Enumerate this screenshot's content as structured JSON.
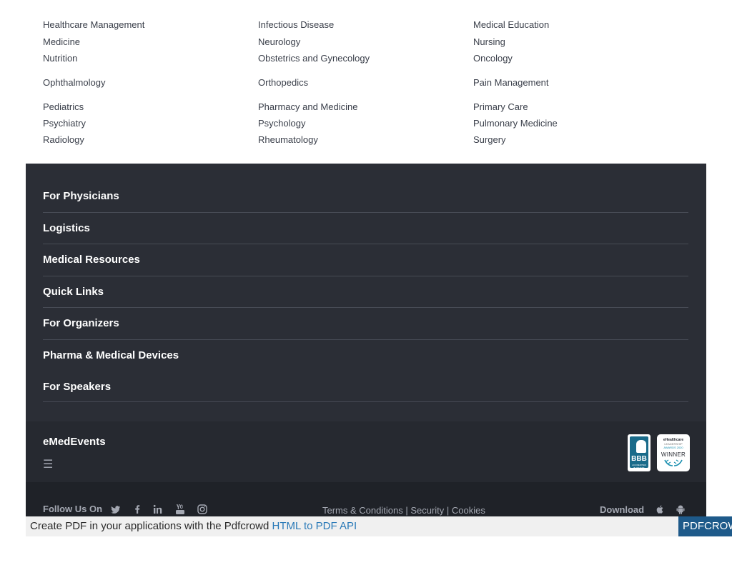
{
  "specialties": [
    [
      "Healthcare Management",
      "Infectious Disease",
      "Medical Education"
    ],
    [
      "Medicine",
      "Neurology",
      "Nursing"
    ],
    [
      "Nutrition",
      "Obstetrics and Gynecology",
      "Oncology"
    ],
    [
      "Ophthalmology",
      "Orthopedics",
      "Pain Management"
    ],
    [
      "Pediatrics",
      "Pharmacy and Medicine",
      "Primary Care"
    ],
    [
      "Psychiatry",
      "Psychology",
      "Pulmonary Medicine"
    ],
    [
      "Radiology",
      "Rheumatology",
      "Surgery"
    ]
  ],
  "footer_menu": [
    "For Physicians",
    "Logistics",
    "Medical Resources",
    "Quick Links",
    "For Organizers",
    "Pharma & Medical Devices",
    "For Speakers"
  ],
  "brand": {
    "name": "eMedEvents",
    "menu_icon": "☰"
  },
  "badges": {
    "bbb": {
      "title": "BBB",
      "subtitle": "ACCREDITED BUSINESS"
    },
    "award": {
      "line1": "eHealthcare",
      "line2": "LEADERSHIP",
      "line3": "AWARDS 2020",
      "line4": "WINNER"
    }
  },
  "bottom_bar": {
    "follow_label": "Follow Us On",
    "social_icons": [
      "twitter-icon",
      "facebook-icon",
      "linkedin-icon",
      "youtube-icon",
      "instagram-icon"
    ],
    "terms": "Terms & Conditions",
    "sep1": " | ",
    "security": "Security",
    "sep2": " | ",
    "cookies": "Cookies",
    "download_label": "Download",
    "app_icons": [
      "apple-icon",
      "android-icon"
    ]
  },
  "pdfcrowd": {
    "text": "Create PDF in your applications with the Pdfcrowd ",
    "link": "HTML to PDF API",
    "button": "PDFCROWD"
  },
  "colors": {
    "footer_bg": "#2b2e36",
    "brand_band_bg": "#262930",
    "bottom_bg": "#1f2228",
    "link_blue": "#2a7ab8"
  }
}
